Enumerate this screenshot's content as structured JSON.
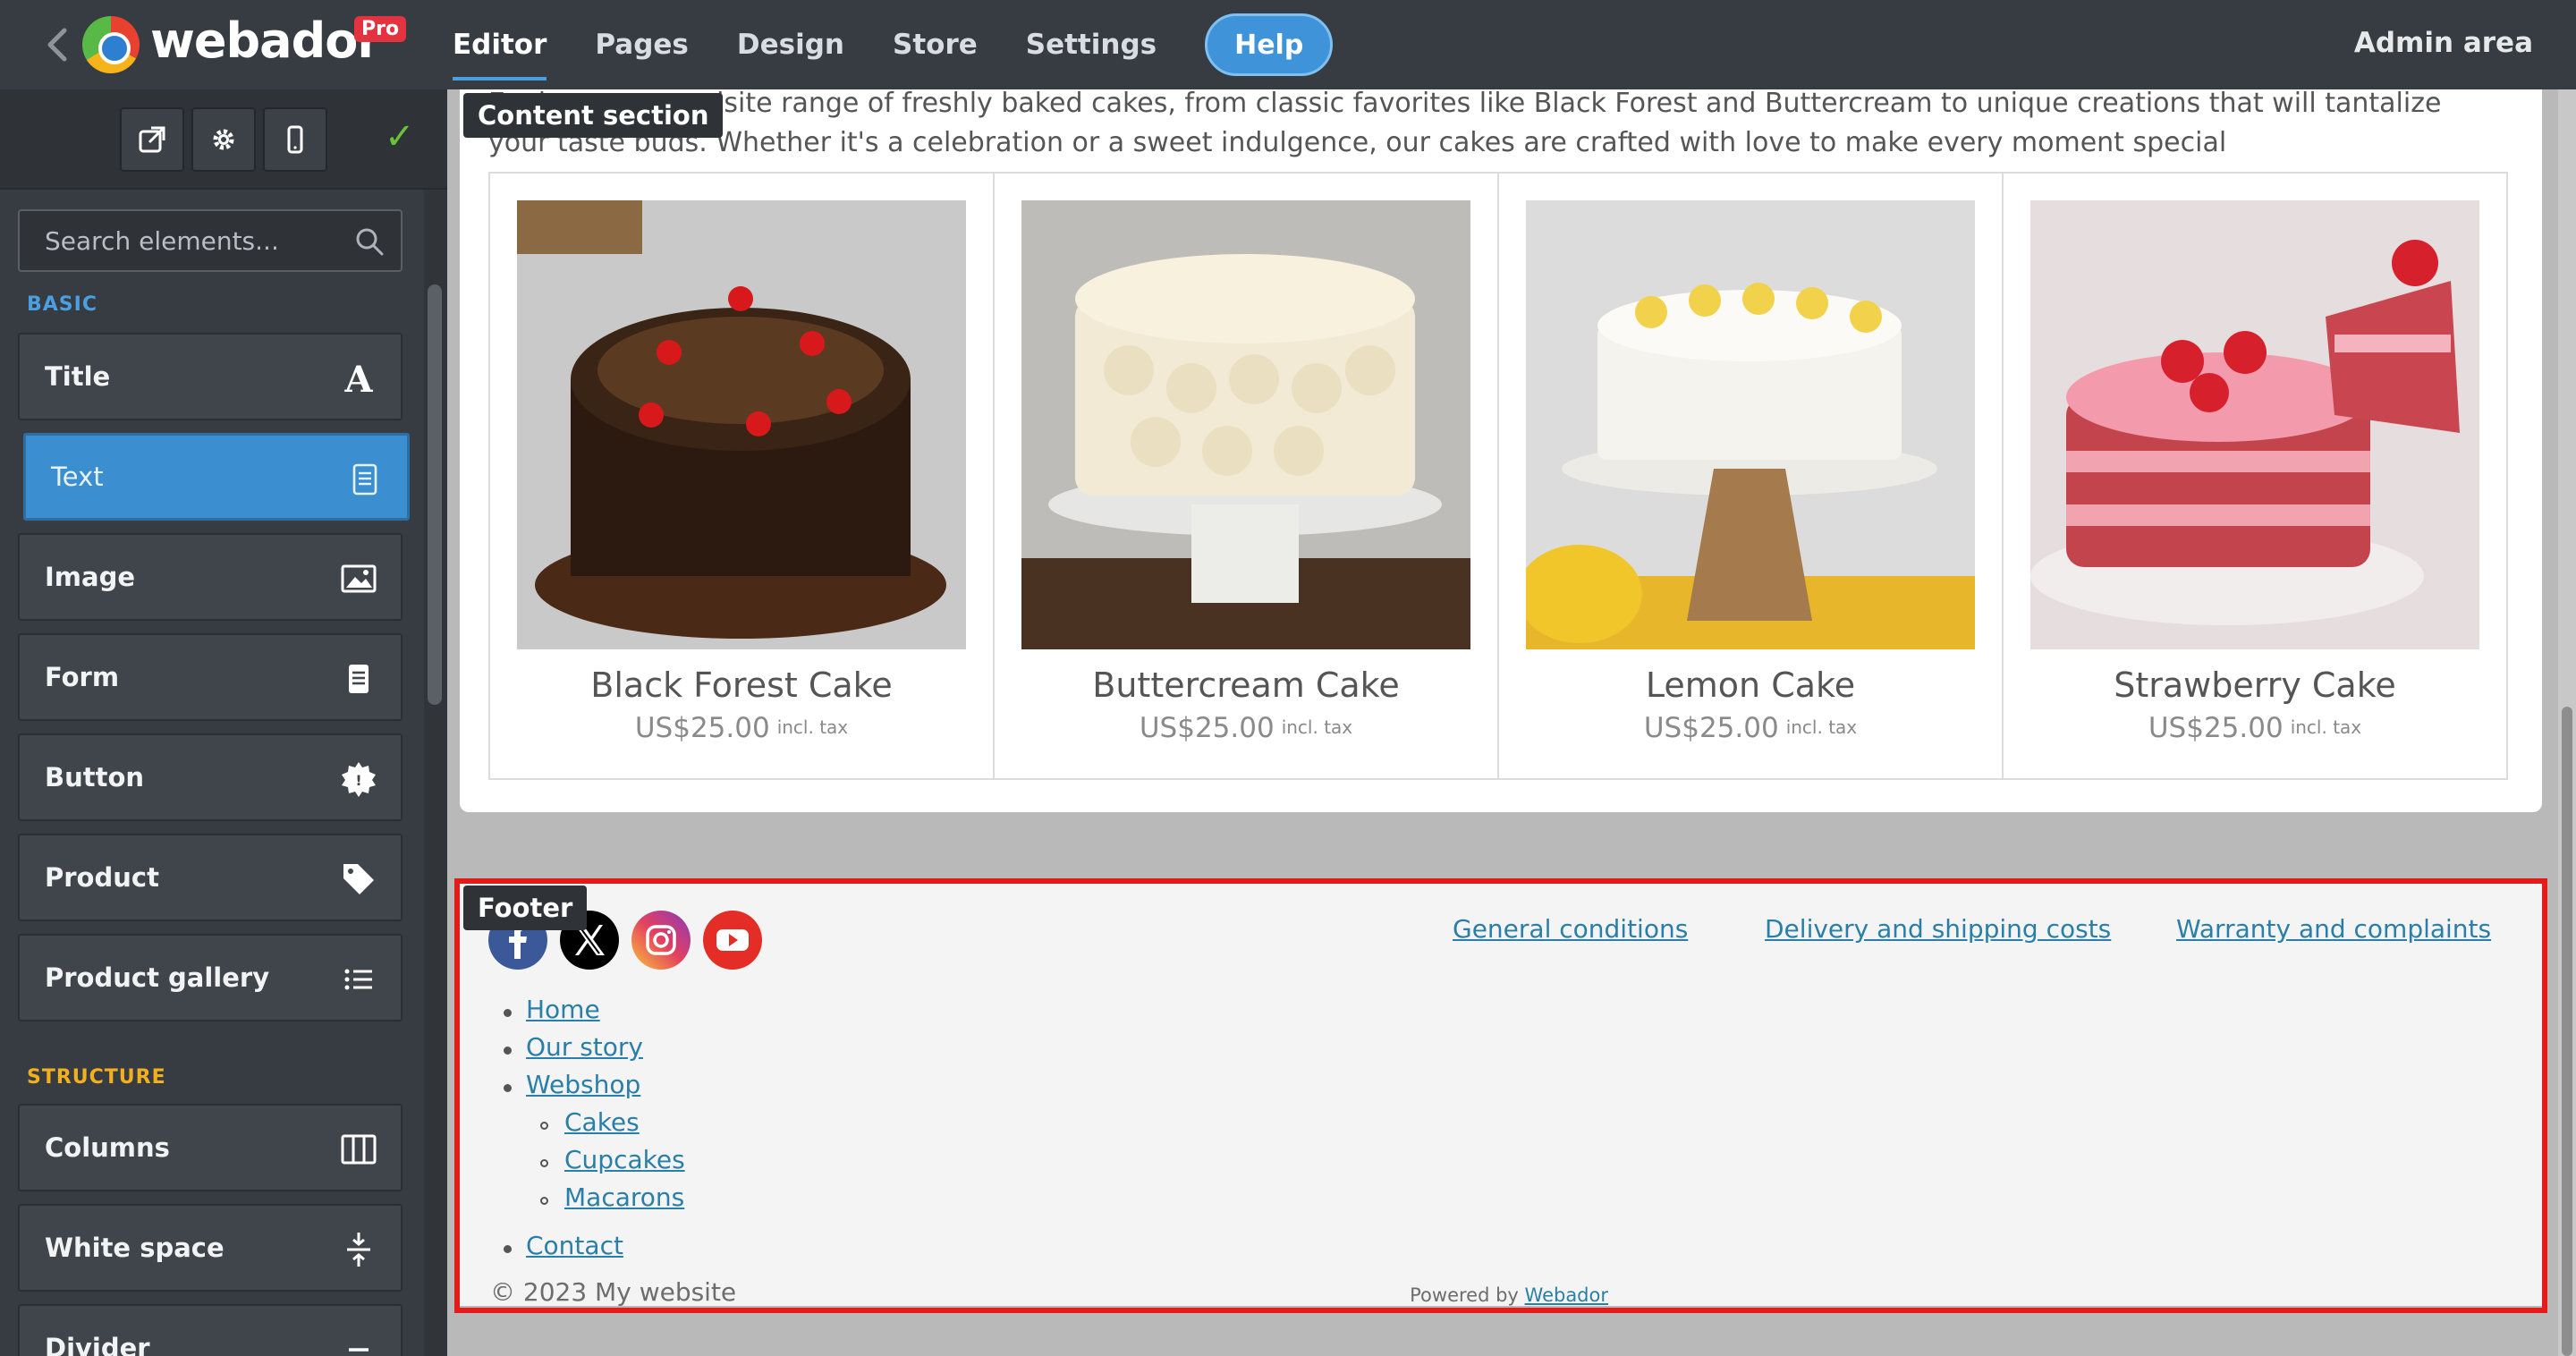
{
  "topbar": {
    "logo_text": "webador",
    "pro_badge": "Pro",
    "nav": [
      "Editor",
      "Pages",
      "Design",
      "Store",
      "Settings"
    ],
    "help": "Help",
    "admin": "Admin area"
  },
  "sidebar": {
    "search_placeholder": "Search elements...",
    "basic_label": "BASIC",
    "structure_label": "STRUCTURE",
    "basic_items": [
      "Title",
      "Text",
      "Image",
      "Form",
      "Button",
      "Product",
      "Product gallery"
    ],
    "structure_items": [
      "Columns",
      "White space",
      "Divider"
    ]
  },
  "content": {
    "tag": "Content section",
    "intro": "Explore our exquisite range of freshly baked cakes, from classic favorites like Black Forest and Buttercream to unique creations that will tantalize your taste buds. Whether it's a celebration or a sweet indulgence, our cakes are crafted with love to make every moment special",
    "products": [
      {
        "name": "Black Forest Cake",
        "price": "US$25.00",
        "tax": "incl. tax"
      },
      {
        "name": "Buttercream Cake",
        "price": "US$25.00",
        "tax": "incl. tax"
      },
      {
        "name": "Lemon Cake",
        "price": "US$25.00",
        "tax": "incl. tax"
      },
      {
        "name": "Strawberry Cake",
        "price": "US$25.00",
        "tax": "incl. tax"
      }
    ]
  },
  "footer": {
    "tag": "Footer",
    "links": [
      "General conditions",
      "Delivery and shipping costs",
      "Warranty and complaints"
    ],
    "menu": [
      "Home",
      "Our story",
      "Webshop",
      "Cakes",
      "Cupcakes",
      "Macarons",
      "Contact"
    ],
    "copyright": "© 2023 My website",
    "powered_by": "Powered by",
    "powered_brand": "Webador"
  },
  "colors": {
    "accent": "#3b8fd1",
    "topbar": "#373c42",
    "section_basic": "#4a9fe0",
    "section_structure": "#f2b01e",
    "outline": "#e31b1b",
    "link": "#2a7fa8"
  }
}
